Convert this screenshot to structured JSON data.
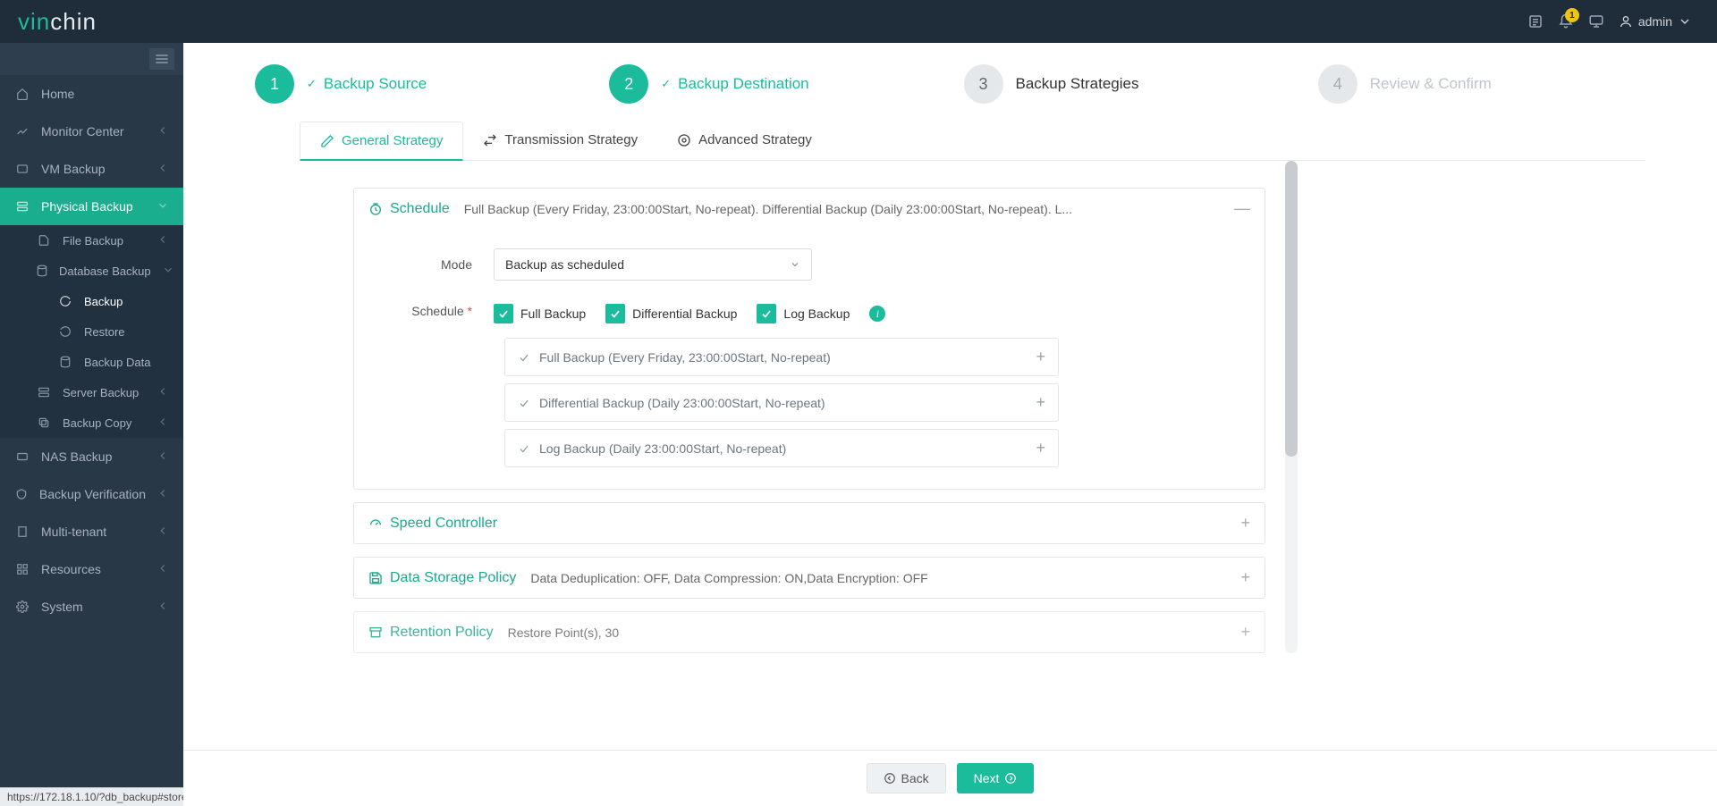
{
  "brand": {
    "part1": "vin",
    "part2": "chin"
  },
  "topbar": {
    "notification_count": "1",
    "user": "admin"
  },
  "status_url": "https://172.18.1.10/?db_backup#store",
  "sidebar": {
    "items": [
      {
        "label": "Home"
      },
      {
        "label": "Monitor Center"
      },
      {
        "label": "VM Backup"
      },
      {
        "label": "Physical Backup"
      },
      {
        "label": "NAS Backup"
      },
      {
        "label": "Backup Verification"
      },
      {
        "label": "Multi-tenant"
      },
      {
        "label": "Resources"
      },
      {
        "label": "System"
      }
    ],
    "physical_sub": [
      {
        "label": "File Backup"
      },
      {
        "label": "Database Backup"
      },
      {
        "label": "Server Backup"
      },
      {
        "label": "Backup Copy"
      }
    ],
    "db_sub": [
      {
        "label": "Backup"
      },
      {
        "label": "Restore"
      },
      {
        "label": "Backup Data"
      }
    ]
  },
  "steps": [
    {
      "num": "1",
      "label": "Backup Source"
    },
    {
      "num": "2",
      "label": "Backup Destination"
    },
    {
      "num": "3",
      "label": "Backup Strategies"
    },
    {
      "num": "4",
      "label": "Review & Confirm"
    }
  ],
  "tabs": [
    {
      "label": "General Strategy"
    },
    {
      "label": "Transmission Strategy"
    },
    {
      "label": "Advanced Strategy"
    }
  ],
  "schedule": {
    "title": "Schedule",
    "summary": "Full Backup (Every Friday, 23:00:00Start, No-repeat). Differential Backup (Daily 23:00:00Start, No-repeat). L...",
    "mode_label": "Mode",
    "mode_value": "Backup as scheduled",
    "schedule_label": "Schedule",
    "checks": [
      {
        "label": "Full Backup"
      },
      {
        "label": "Differential Backup"
      },
      {
        "label": "Log Backup"
      }
    ],
    "items": [
      {
        "label": "Full Backup (Every Friday, 23:00:00Start, No-repeat)"
      },
      {
        "label": "Differential Backup (Daily 23:00:00Start, No-repeat)"
      },
      {
        "label": "Log Backup (Daily 23:00:00Start, No-repeat)"
      }
    ]
  },
  "cards": {
    "speed": {
      "title": "Speed Controller",
      "summary": ""
    },
    "storage": {
      "title": "Data Storage Policy",
      "summary": "Data Deduplication: OFF, Data Compression: ON,Data Encryption: OFF"
    },
    "retention": {
      "title": "Retention Policy",
      "summary": "Restore Point(s), 30"
    }
  },
  "footer": {
    "back": "Back",
    "next": "Next"
  }
}
